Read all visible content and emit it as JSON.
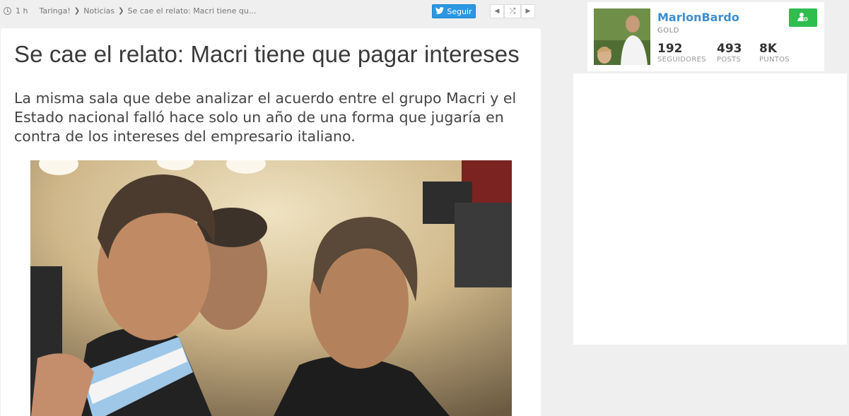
{
  "breadcrumb": {
    "time": "1 h",
    "items": [
      "Taringa!",
      "Noticias",
      "Se cae el relato: Macri tiene qu..."
    ]
  },
  "toolbar": {
    "follow_label": "Seguir",
    "prev_icon": "chevron-left-icon",
    "random_icon": "shuffle-icon",
    "next_icon": "chevron-right-icon"
  },
  "article": {
    "title": "Se cae el relato: Macri tiene que pagar intereses",
    "lede": "La misma sala que debe analizar el acuerdo entre el grupo Macri y el Estado nacional falló hace solo un año de una forma que jugaría en contra de los intereses del empresario italiano."
  },
  "user": {
    "name": "MarlonBardo",
    "rank": "GOLD",
    "stats": [
      {
        "value": "192",
        "label": "SEGUIDORES"
      },
      {
        "value": "493",
        "label": "POSTS"
      },
      {
        "value": "8K",
        "label": "PUNTOS"
      }
    ]
  },
  "colors": {
    "accent_blue": "#2b97e3",
    "follow_green": "#2ebd4f",
    "username_blue": "#3d8fcf"
  }
}
